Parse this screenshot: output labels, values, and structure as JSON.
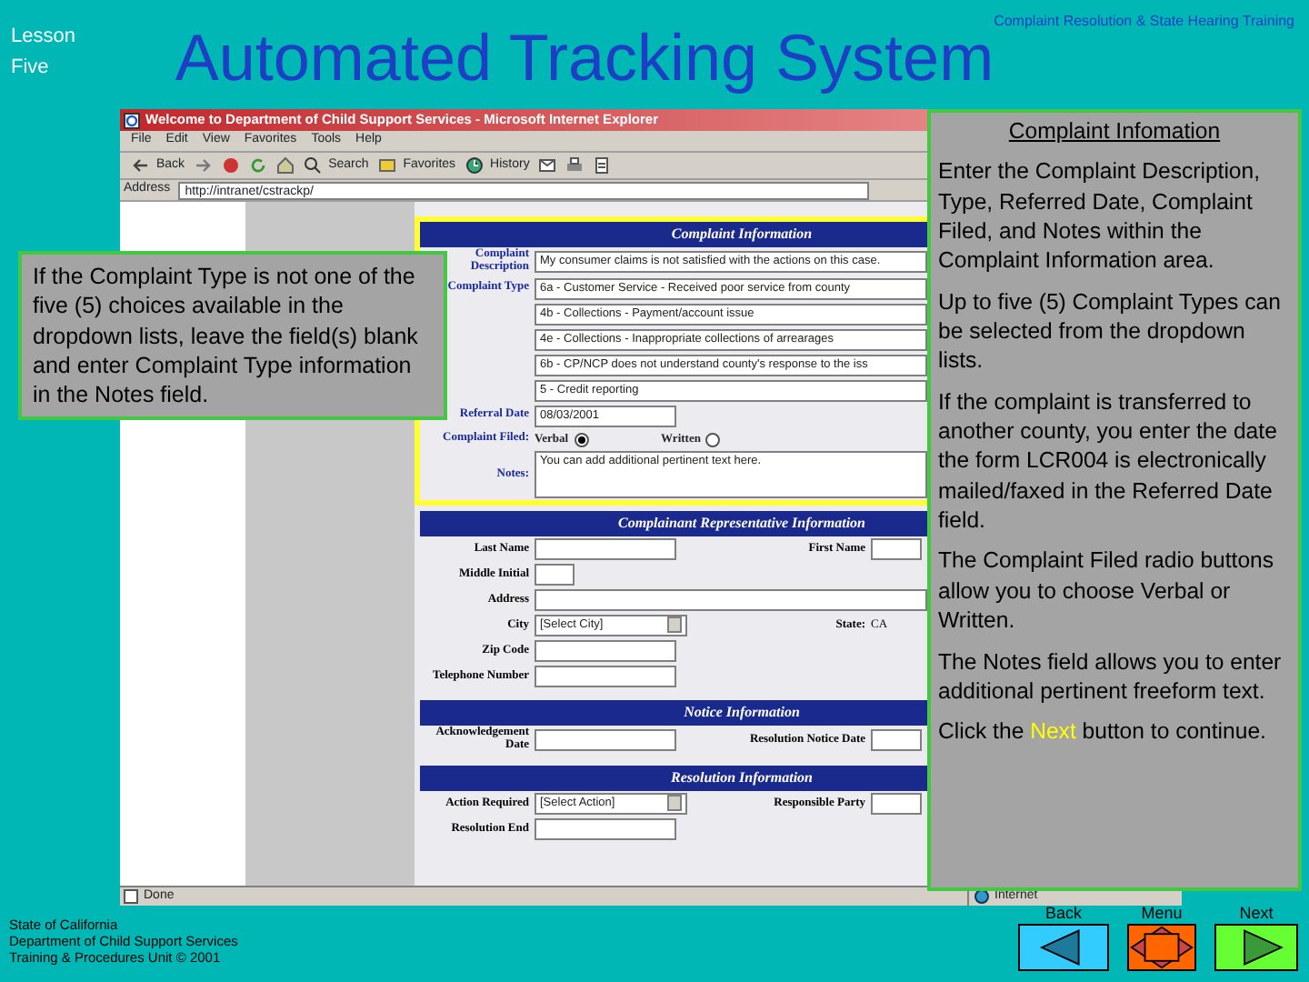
{
  "header": {
    "lesson": "Lesson Five",
    "title": "Automated Tracking System",
    "course": "Complaint Resolution & State Hearing Training"
  },
  "browser": {
    "title": "Welcome to Department of Child Support Services - Microsoft Internet Explorer",
    "menu": [
      "File",
      "Edit",
      "View",
      "Favorites",
      "Tools",
      "Help"
    ],
    "toolbar": [
      {
        "kind": "back",
        "label": "Back"
      },
      {
        "kind": "forward"
      },
      {
        "kind": "stop"
      },
      {
        "kind": "refresh"
      },
      {
        "kind": "home"
      },
      {
        "kind": "search",
        "label": "Search"
      },
      {
        "kind": "favorites",
        "label": "Favorites"
      },
      {
        "kind": "history",
        "label": "History"
      },
      {
        "kind": "mail"
      },
      {
        "kind": "print"
      },
      {
        "kind": "edit"
      }
    ],
    "address_label": "Address",
    "address": "http://intranet/cstrackp/",
    "status": "Done",
    "zone": "Internet"
  },
  "form": [
    {
      "title": "Complaint Information",
      "highlighted": true,
      "rows": [
        {
          "fields": [
            {
              "kind": "text",
              "label": "Complaint Description",
              "value": "My consumer claims is not satisfied with the actions on this case."
            }
          ]
        },
        {
          "fields": [
            {
              "kind": "text",
              "label": "Complaint Type",
              "value": "6a - Customer Service - Received poor service from county"
            }
          ]
        },
        {
          "fields": [
            {
              "kind": "text",
              "value": "4b - Collections - Payment/account issue"
            }
          ]
        },
        {
          "fields": [
            {
              "kind": "text",
              "value": "4e - Collections - Inappropriate collections of arrearages"
            }
          ]
        },
        {
          "fields": [
            {
              "kind": "text",
              "value": "6b - CP/NCP does not understand county's response to the iss"
            }
          ]
        },
        {
          "fields": [
            {
              "kind": "text",
              "value": "5 - Credit reporting"
            }
          ]
        },
        {
          "fields": [
            {
              "kind": "short",
              "label": "Referral Date",
              "value": "08/03/2001"
            }
          ]
        },
        {
          "fields": [
            {
              "kind": "radio",
              "label": "Complaint Filed:",
              "options": [
                {
                  "label": "Verbal",
                  "selected": true
                },
                {
                  "label": "Written",
                  "selected": false
                }
              ]
            }
          ]
        },
        {
          "fields": [
            {
              "kind": "textarea",
              "label": "Notes:",
              "value": "You can add additional pertinent text here."
            }
          ]
        }
      ]
    },
    {
      "title": "Complainant Representative Information",
      "highlighted": false,
      "rows": [
        {
          "fields": [
            {
              "kind": "short",
              "label": "Last Name"
            },
            {
              "kind": "short",
              "label": "First Name"
            }
          ]
        },
        {
          "fields": [
            {
              "kind": "tiny",
              "label": "Middle Initial"
            }
          ]
        },
        {
          "fields": [
            {
              "kind": "text",
              "label": "Address"
            }
          ]
        },
        {
          "fields": [
            {
              "kind": "select",
              "label": "City",
              "value": "[Select City]"
            },
            {
              "kind": "plain",
              "label": "State:",
              "value": "CA"
            }
          ]
        },
        {
          "fields": [
            {
              "kind": "short",
              "label": "Zip Code"
            }
          ]
        },
        {
          "fields": [
            {
              "kind": "short",
              "label": "Telephone Number"
            }
          ]
        }
      ]
    },
    {
      "title": "Notice Information",
      "highlighted": false,
      "rows": [
        {
          "fields": [
            {
              "kind": "short",
              "label": "Acknowledgement Date"
            },
            {
              "kind": "short",
              "label": "Resolution Notice Date"
            }
          ]
        }
      ]
    },
    {
      "title": "Resolution Information",
      "highlighted": false,
      "rows": [
        {
          "fields": [
            {
              "kind": "select",
              "label": "Action Required",
              "value": "[Select Action]"
            },
            {
              "kind": "short",
              "label": "Responsible Party"
            }
          ]
        },
        {
          "fields": [
            {
              "kind": "short",
              "label": "Resolution End"
            }
          ]
        }
      ]
    }
  ],
  "left_note": "If the Complaint Type is not one of the five (5) choices available in the dropdown lists, leave the field(s) blank and enter Complaint Type information in the Notes field.",
  "info_panel": {
    "heading": "Complaint Infomation",
    "paragraphs": [
      {
        "text": "Enter the Complaint Description, Type, Referred Date, Complaint Filed, and Notes within the Complaint Information area."
      },
      {
        "text": "Up to five (5) Complaint Types can be selected from the dropdown lists."
      },
      {
        "text": "If the complaint is transferred to another county, you enter the date the form LCR004 is electronically mailed/faxed in the Referred Date field."
      },
      {
        "text": "The Complaint Filed radio buttons allow you to choose Verbal or Written."
      },
      {
        "text": "The Notes field allows you to enter additional pertinent freeform text."
      },
      {
        "before": "Click the ",
        "highlight": "Next",
        "after": " button to continue."
      }
    ]
  },
  "footer": [
    "State of California",
    "Department of Child Support Services",
    "Training & Procedures Unit  © 2001"
  ],
  "nav": [
    {
      "kind": "back",
      "label": "Back",
      "color": "#33ccff"
    },
    {
      "kind": "menu",
      "label": "Menu",
      "color": "#ff6600"
    },
    {
      "kind": "next",
      "label": "Next",
      "color": "#66ff33"
    }
  ]
}
